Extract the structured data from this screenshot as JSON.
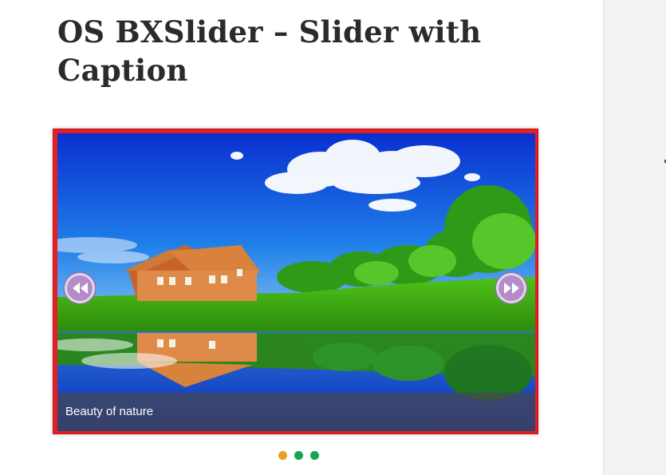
{
  "page": {
    "title": "OS BXSlider – Slider with Caption"
  },
  "slider": {
    "caption": "Beauty of nature",
    "slide_count": 3,
    "active_slide": 1,
    "colors": {
      "frame": "#e31e24",
      "nav_button": "#b48cc8",
      "pager_active": "#e8a21a",
      "pager_inactive": "#13a84a"
    },
    "prev_icon": "rewind-icon",
    "next_icon": "fast-forward-icon"
  }
}
